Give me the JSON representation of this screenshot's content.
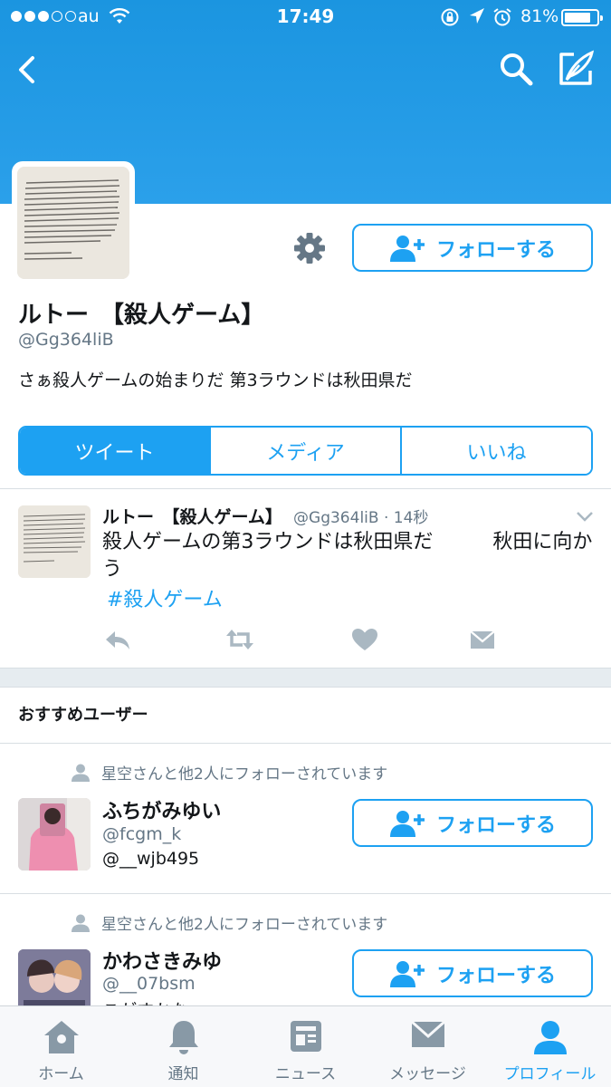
{
  "status_bar": {
    "carrier": "au",
    "time": "17:49",
    "battery_percent": "81%",
    "battery_level": 0.81,
    "signal_bars": 3
  },
  "nav": {
    "icons": [
      "back-icon",
      "search-icon",
      "compose-tweet-icon"
    ]
  },
  "profile": {
    "display_name": "ルトー　【殺人ゲーム】",
    "handle": "@Gg364liB",
    "bio": "さぁ殺人ゲームの始まりだ 第3ラウンドは秋田県だ",
    "follow_label": "フォローする"
  },
  "tabs": [
    {
      "label": "ツイート",
      "active": true
    },
    {
      "label": "メディア",
      "active": false
    },
    {
      "label": "いいね",
      "active": false
    }
  ],
  "tweet": {
    "name": "ルトー　【殺人ゲーム】",
    "handle_time": "@Gg364liB · 14秒",
    "text": "殺人ゲームの第3ラウンドは秋田県だ　　　秋田に向かう",
    "hashtag": "#殺人ゲーム"
  },
  "recommended": {
    "title": "おすすめユーザー",
    "users": [
      {
        "context": "星空さんと他2人にフォローされています",
        "name": "ふちがみゆい",
        "handle": "@fcgm_k",
        "bio": "@__wjb495",
        "follow_label": "フォローする"
      },
      {
        "context": "星空さんと他2人にフォローされています",
        "name": "かわさきみゆ",
        "handle": "@__07bsm",
        "bio": "こがすかな",
        "follow_label": "フォローする"
      }
    ]
  },
  "tabbar": [
    {
      "label": "ホーム",
      "icon": "home-icon",
      "active": false
    },
    {
      "label": "通知",
      "icon": "bell-icon",
      "active": false
    },
    {
      "label": "ニュース",
      "icon": "news-icon",
      "active": false
    },
    {
      "label": "メッセージ",
      "icon": "envelope-icon",
      "active": false
    },
    {
      "label": "プロフィール",
      "icon": "profile-icon",
      "active": true
    }
  ],
  "colors": {
    "accent": "#1da1f2",
    "header": "#1b95e0",
    "secondary_text": "#657786",
    "icon_gray": "#aab8c2"
  }
}
